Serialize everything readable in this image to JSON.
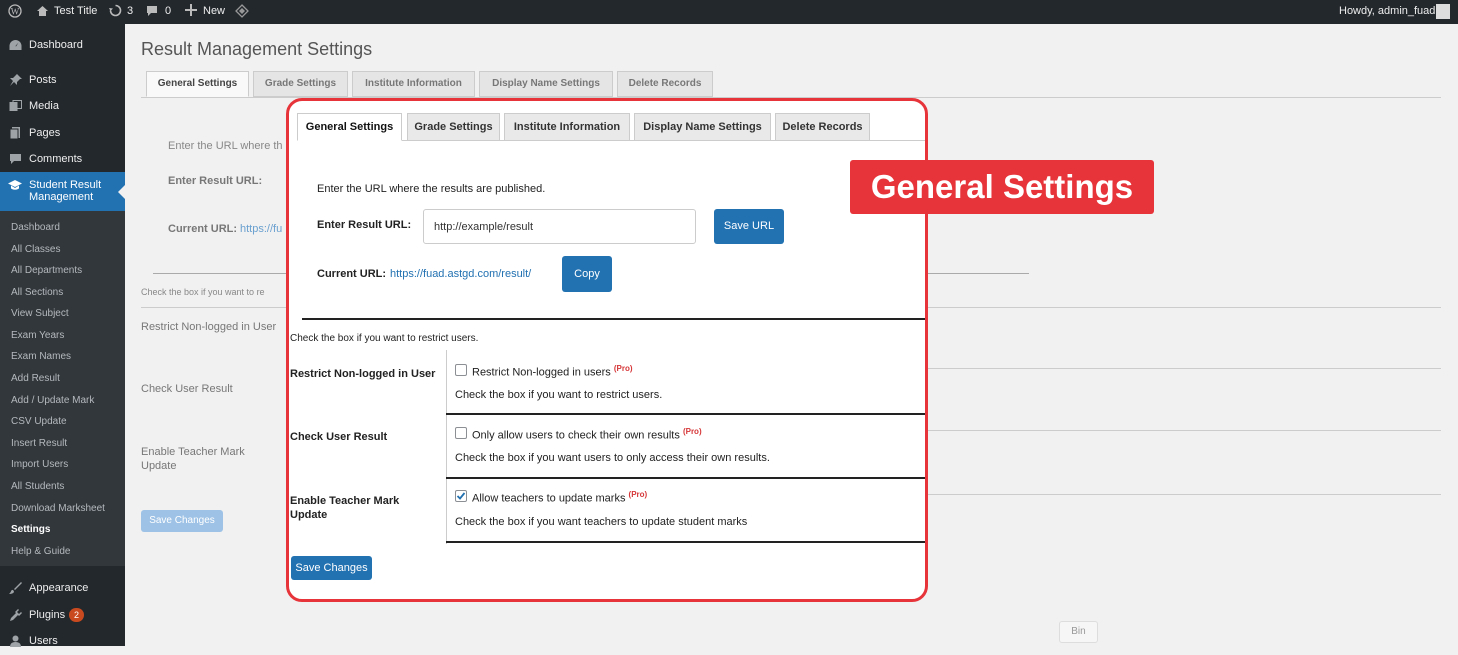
{
  "admin_bar": {
    "site_title": "Test Title",
    "updates_count": "3",
    "comments_count": "0",
    "new_label": "New",
    "howdy": "Howdy, admin_fuad"
  },
  "sidebar": {
    "menu": [
      {
        "label": "Dashboard",
        "icon": "dashboard-icon"
      },
      {
        "label": "Posts",
        "icon": "pin-icon"
      },
      {
        "label": "Media",
        "icon": "media-icon"
      },
      {
        "label": "Pages",
        "icon": "pages-icon"
      },
      {
        "label": "Comments",
        "icon": "comment-icon"
      }
    ],
    "active_menu": "Student Result Management",
    "submenu": [
      "Dashboard",
      "All Classes",
      "All Departments",
      "All Sections",
      "View Subject",
      "Exam Years",
      "Exam Names",
      "Add Result",
      "Add / Update Mark",
      "CSV Update",
      "Insert Result",
      "Import Users",
      "All Students",
      "Download Marksheet",
      "Settings",
      "Help & Guide"
    ],
    "bottom_menu": [
      {
        "label": "Appearance",
        "icon": "brush-icon"
      },
      {
        "label": "Plugins",
        "icon": "plugin-icon",
        "badge": "2"
      },
      {
        "label": "Users",
        "icon": "users-icon"
      }
    ]
  },
  "page": {
    "title": "Result Management Settings",
    "tabs": [
      "General Settings",
      "Grade Settings",
      "Institute Information",
      "Display Name Settings",
      "Delete Records"
    ],
    "bg_text": {
      "enter_url_hint": "Enter the URL where th",
      "enter_result_url": "Enter Result URL:",
      "current_url_label": "Current URL:",
      "current_url_link": "https://fu",
      "check_box_hint": "Check the box if you want to re",
      "restrict_label": "Restrict Non-logged in User",
      "check_user_label": "Check User Result",
      "enable_teacher_label": "Enable Teacher Mark Update",
      "save_changes": "Save Changes",
      "bin_label": "Bin"
    }
  },
  "panel": {
    "tabs": [
      "General Settings",
      "Grade Settings",
      "Institute Information",
      "Display Name Settings",
      "Delete Records"
    ],
    "active_tab": "General Settings",
    "url_hint": "Enter the URL where the results are published.",
    "enter_result_url": "Enter Result URL:",
    "url_value": "http://example/result",
    "save_url": "Save URL",
    "current_url_label": "Current URL:",
    "current_url_link": "https://fuad.astgd.com/result/",
    "copy": "Copy",
    "check_hint": "Check the box if you want to restrict users.",
    "pro_tag": "(Pro)",
    "rows": [
      {
        "label": "Restrict Non-logged in User",
        "checkbox": "Restrict Non-logged in users",
        "checked": false,
        "desc": "Check the box if you want to restrict users."
      },
      {
        "label": "Check User Result",
        "checkbox": "Only allow users to check their own results",
        "checked": false,
        "desc": "Check the box if you want users to only access their own results."
      },
      {
        "label": "Enable Teacher Mark Update",
        "checkbox": "Allow teachers to update marks",
        "checked": true,
        "desc": "Check the box if you want teachers to update student marks"
      }
    ],
    "save_changes": "Save Changes"
  },
  "banner": "General Settings",
  "colors": {
    "accent": "#e6343a",
    "primary": "#2271b1",
    "admin_bg": "#23282d",
    "active_menu": "#2271b1"
  }
}
